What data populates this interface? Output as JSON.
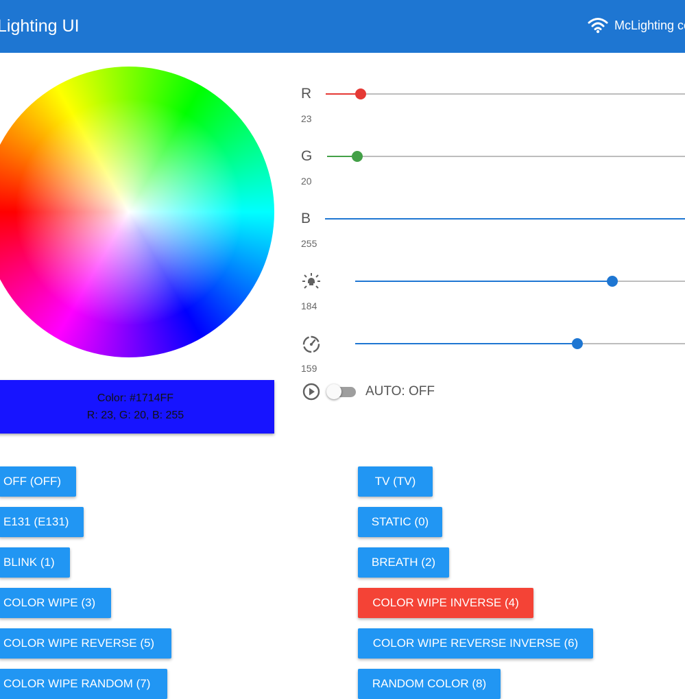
{
  "app": {
    "title": "Lighting UI",
    "connection": "McLighting co"
  },
  "colors": {
    "accent": "#1e76d2",
    "button": "#2196f3",
    "active": "#f44336",
    "red": "#e53935",
    "green": "#43a047",
    "blue": "#1e76d2"
  },
  "color_display": {
    "line1": "Color: #1714FF",
    "line2": "R: 23, G: 20, B: 255",
    "hex": "#1714FF"
  },
  "sliders": {
    "r": {
      "label": "R",
      "value": 23,
      "max": 255
    },
    "g": {
      "label": "G",
      "value": 20,
      "max": 255
    },
    "b": {
      "label": "B",
      "value": 255,
      "max": 255
    },
    "brightness": {
      "icon": "brightness-icon",
      "value": 184,
      "max": 255
    },
    "speed": {
      "icon": "speed-icon",
      "value": 159,
      "max": 255
    }
  },
  "auto": {
    "icon": "play-circle-icon",
    "label": "AUTO: OFF",
    "on": false
  },
  "modes": {
    "left": [
      "OFF (OFF)",
      "E131 (E131)",
      "BLINK (1)",
      "COLOR WIPE (3)",
      "COLOR WIPE REVERSE (5)",
      "COLOR WIPE RANDOM (7)"
    ],
    "right": [
      "TV (TV)",
      "STATIC (0)",
      "BREATH (2)",
      "COLOR WIPE INVERSE (4)",
      "COLOR WIPE REVERSE INVERSE (6)",
      "RANDOM COLOR (8)"
    ],
    "active": "COLOR WIPE INVERSE (4)"
  }
}
